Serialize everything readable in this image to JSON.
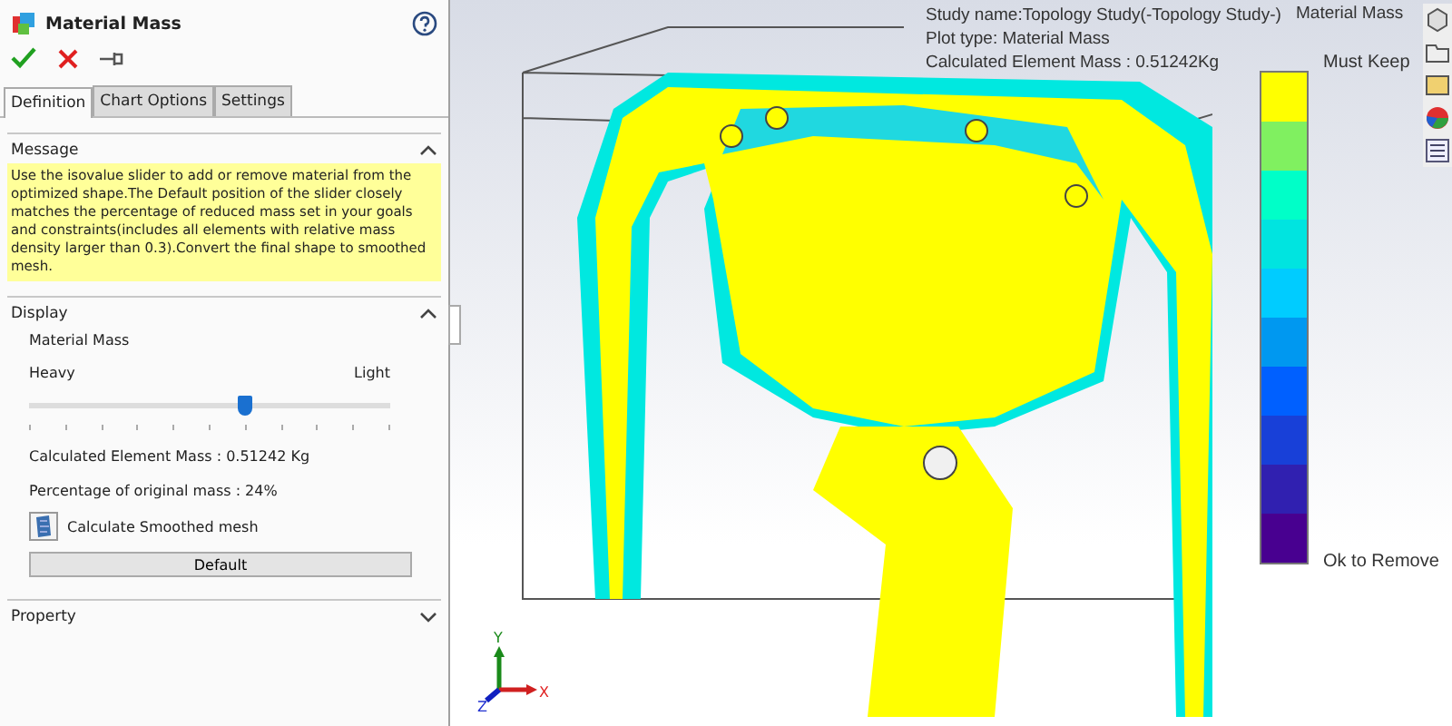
{
  "panel": {
    "title": "Material Mass",
    "tabs": [
      {
        "label": "Definition",
        "selected": true
      },
      {
        "label": "Chart Options",
        "selected": false
      },
      {
        "label": "Settings",
        "selected": false
      }
    ],
    "sections": [
      {
        "kind": "message",
        "title": "Message",
        "expanded": true,
        "text": "Use the isovalue slider to add or remove material from the optimized shape.The Default  position of the slider closely matches the percentage of reduced mass set in your goals and constraints(includes all elements with relative mass density larger than 0.3).Convert the final shape to smoothed mesh."
      },
      {
        "kind": "display",
        "title": "Display",
        "expanded": true,
        "slider_title": "Material Mass",
        "min_label": "Heavy",
        "max_label": "Light",
        "level": 0.6,
        "mass": "Calculated Element Mass : 0.51242 Kg",
        "percentage": "Percentage of original mass : 24%",
        "smooth_label": "Calculate Smoothed mesh",
        "default_button": "Default"
      },
      {
        "kind": "property",
        "title": "Property",
        "expanded": false
      }
    ]
  },
  "viewport": {
    "info": [
      "Study name:Topology Study(-Topology Study-)",
      "Plot type: Material Mass",
      "Calculated Element Mass :  0.51242Kg"
    ],
    "legend": {
      "title": "Material Mass",
      "top_label": "Must Keep",
      "bottom_label": "Ok to Remove",
      "bands": [
        {
          "color": "#ffff00"
        },
        {
          "color": "#80f060"
        },
        {
          "color": "#00ffc8"
        },
        {
          "color": "#00e4e0"
        },
        {
          "color": "#00ccff"
        },
        {
          "color": "#0098f0"
        },
        {
          "color": "#0060ff"
        },
        {
          "color": "#1840d8"
        },
        {
          "color": "#3020b0"
        },
        {
          "color": "#480090"
        }
      ]
    },
    "triad": {
      "x": "X",
      "y": "Y",
      "z": "Z"
    }
  }
}
